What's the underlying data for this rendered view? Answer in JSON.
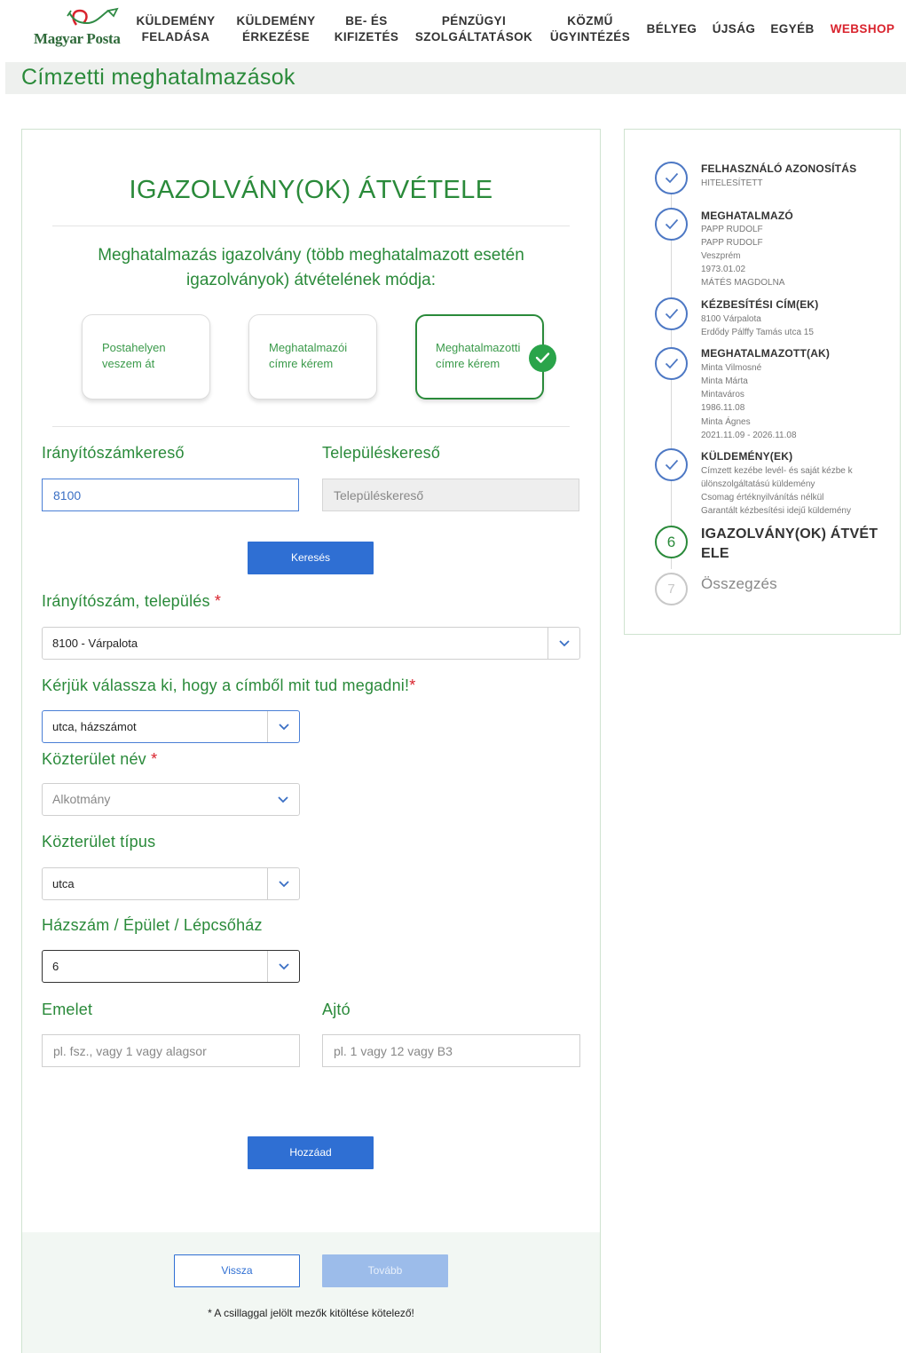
{
  "header": {
    "logo_text": "Magyar Posta",
    "nav": [
      {
        "label": "KÜLDEMÉNY\nFELADÁSA"
      },
      {
        "label": "KÜLDEMÉNY\nÉRKEZÉSE"
      },
      {
        "label": "BE- ÉS\nKIFIZETÉS"
      },
      {
        "label": "PÉNZÜGYI\nSZOLGÁLTATÁSOK"
      },
      {
        "label": "KÖZMŰ\nÜGYINTÉZÉS"
      },
      {
        "label": "BÉLYEG"
      },
      {
        "label": "ÚJSÁG"
      },
      {
        "label": "EGYÉB"
      },
      {
        "label": "WEBSHOP"
      }
    ],
    "accent_color": "#d9232d"
  },
  "page": {
    "title": "Címzetti meghatalmazások"
  },
  "form": {
    "heading": "IGAZOLVÁNY(OK) ÁTVÉTELE",
    "subtitle": "Meghatalmazás igazolvány (több meghatalmazott esetén igazolványok) átvételének módja:",
    "options": [
      {
        "label": "Postahelyen veszem át",
        "selected": false
      },
      {
        "label": "Meghatalmazói címre kérem",
        "selected": false
      },
      {
        "label": "Meghatalmazotti címre kérem",
        "selected": true
      }
    ],
    "zip_search_label": "Irányítószámkereső",
    "zip_search_value": "8100",
    "city_search_label": "Településkereső",
    "city_search_placeholder": "Településkereső",
    "search_button": "Keresés",
    "zip_city_label": "Irányítószám, település",
    "zip_city_value": "8100 - Várpalota",
    "address_choice_label": "Kérjük válassza ki, hogy a címből mit tud megadni!",
    "address_choice_value": "utca, házszámot",
    "street_name_label": "Közterület név",
    "street_name_value": "Alkotmány",
    "street_type_label": "Közterület típus",
    "street_type_value": "utca",
    "house_label": "Házszám / Épület / Lépcsőház",
    "house_value": "6",
    "floor_label": "Emelet",
    "floor_placeholder": "pl. fsz., vagy 1 vagy alagsor",
    "door_label": "Ajtó",
    "door_placeholder": "pl. 1 vagy 12 vagy B3",
    "add_button": "Hozzáad",
    "back_button": "Vissza",
    "next_button": "Tovább",
    "required_note": "* A csillaggal jelölt mezők kitöltése kötelező!",
    "required_mark": "*",
    "brand_green": "#2a8a3a",
    "button_blue": "#2f6fd3"
  },
  "steps": [
    {
      "title": "FELHASZNÁLÓ AZONOSÍTÁS",
      "lines": [
        "HITELESÍTETT"
      ],
      "state": "done"
    },
    {
      "title": "MEGHATALMAZÓ",
      "lines": [
        "PAPP RUDOLF",
        "PAPP RUDOLF",
        "Veszprém",
        "1973.01.02",
        "MÁTÉS MAGDOLNA"
      ],
      "state": "done"
    },
    {
      "title": "KÉZBESÍTÉSI CÍM(EK)",
      "lines": [
        "8100 Várpalota",
        "Erdődy Pálffy Tamás utca 15"
      ],
      "state": "done"
    },
    {
      "title": "MEGHATALMAZOTT(AK)",
      "lines": [
        "Minta Vilmosné",
        "Minta Márta",
        "Mintaváros",
        "1986.11.08",
        "Minta Ágnes",
        "2021.11.09 - 2026.11.08"
      ],
      "state": "done"
    },
    {
      "title": "KÜLDEMÉNY(EK)",
      "lines": [
        "Címzett kezébe levél- és saját kézbe k",
        "ülönszolgáltatású küldemény",
        "Csomag értéknyilvánítás nélkül",
        "Garantált kézbesítési idejű küldemény"
      ],
      "state": "done"
    },
    {
      "number": "6",
      "title": "IGAZOLVÁNY(OK) ÁTVÉTELE",
      "title_display": "IGAZOLVÁNY(OK) ÁTVÉT\nELE",
      "state": "current"
    },
    {
      "number": "7",
      "title": "Összegzés",
      "state": "future"
    }
  ]
}
